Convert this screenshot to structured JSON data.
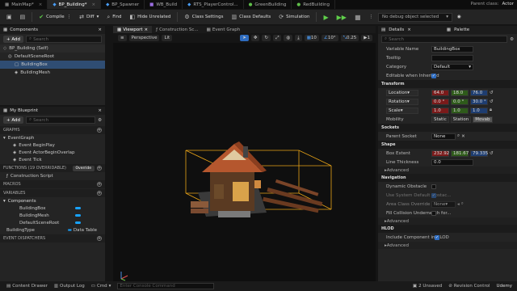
{
  "tabs": [
    {
      "label": "MainMap*",
      "active": false
    },
    {
      "label": "BP_Building*",
      "active": true
    },
    {
      "label": "BP_Spawner",
      "active": false
    },
    {
      "label": "WB_Build",
      "active": false
    },
    {
      "label": "RTS_PlayerControl...",
      "active": false
    },
    {
      "label": "GreenBuilding",
      "active": false
    },
    {
      "label": "RedBuilding",
      "active": false
    }
  ],
  "parent_class": {
    "label": "Parent class:",
    "value": "Actor"
  },
  "toolbar": {
    "compile": "Compile",
    "diff": "Diff",
    "find": "Find",
    "hide_unrelated": "Hide Unrelated",
    "class_settings": "Class Settings",
    "class_defaults": "Class Defaults",
    "simulation": "Simulation",
    "debug_object": "No debug object selected"
  },
  "components": {
    "title": "Components",
    "add": "+ Add",
    "search_placeholder": "Search",
    "tree": [
      "BP_Building (Self)",
      "DefaultSceneRoot",
      "BuildingBox",
      "BuildingMesh"
    ]
  },
  "blueprint": {
    "title": "My Blueprint",
    "add": "+ Add",
    "search_placeholder": "Search",
    "graphs_label": "GRAPHS",
    "event_graph": "EventGraph",
    "events": [
      "Event BeginPlay",
      "Event ActorBeginOverlap",
      "Event Tick"
    ],
    "functions_label": "FUNCTIONS",
    "functions_count": "(19 OVERRIDABLE)",
    "override": "Override",
    "construction_script": "Construction Script",
    "macros_label": "MACROS",
    "variables_label": "VARIABLES",
    "components_label": "Components",
    "component_vars": [
      "BuildingBox",
      "BuildingMesh",
      "DefaultSceneRoot"
    ],
    "building_type": "BuildingType",
    "data_table": "Data Table",
    "event_dispatchers": "EVENT DISPATCHERS"
  },
  "viewport_tabs": {
    "viewport": "Viewport",
    "construction": "Construction Sc...",
    "event_graph": "Event Graph"
  },
  "viewport_tools": {
    "perspective": "Perspective",
    "lit": "Lit",
    "grid": "10",
    "angle": "10°",
    "scale": "0.25",
    "cams": "1"
  },
  "details": {
    "title": "Details",
    "palette": "Palette",
    "search_placeholder": "Search",
    "variable_name_label": "Variable Name",
    "variable_name": "BuildingBox",
    "tooltip_label": "Tooltip",
    "category_label": "Category",
    "category": "Default",
    "editable_label": "Editable when Inherited",
    "transform": "Transform",
    "location_label": "Location",
    "location": [
      "64.0",
      "18.0",
      "76.0"
    ],
    "rotation_label": "Rotation",
    "rotation": [
      "0.0 °",
      "0.0 °",
      "30.0 °"
    ],
    "scale_label": "Scale",
    "scale": [
      "1.0",
      "1.0",
      "1.0"
    ],
    "mobility_label": "Mobility",
    "mobility": [
      "Static",
      "Station",
      "Movab"
    ],
    "sockets": "Sockets",
    "parent_socket_label": "Parent Socket",
    "parent_socket": "None",
    "shape": "Shape",
    "box_extent_label": "Box Extent",
    "box_extent": [
      "232.92",
      "181.67",
      "79.335"
    ],
    "line_thickness_label": "Line Thickness",
    "line_thickness": "0.0",
    "advanced": "Advanced",
    "navigation": "Navigation",
    "dynamic_obstacle": "Dynamic Obstacle",
    "use_system_default": "Use System Default Obstac...",
    "area_class_override": "Area Class Override",
    "area_none": "None",
    "fill_collision": "Fill Collision Underneath for...",
    "hlod": "HLOD",
    "include_hlod": "Include Component in HLOD"
  },
  "bottom": {
    "content_drawer": "Content Drawer",
    "output_log": "Output Log",
    "cmd": "Cmd",
    "console_placeholder": "Enter Console Command",
    "unsaved": "2 Unsaved",
    "revision": "Revision Control",
    "watermark": "Udemy"
  }
}
